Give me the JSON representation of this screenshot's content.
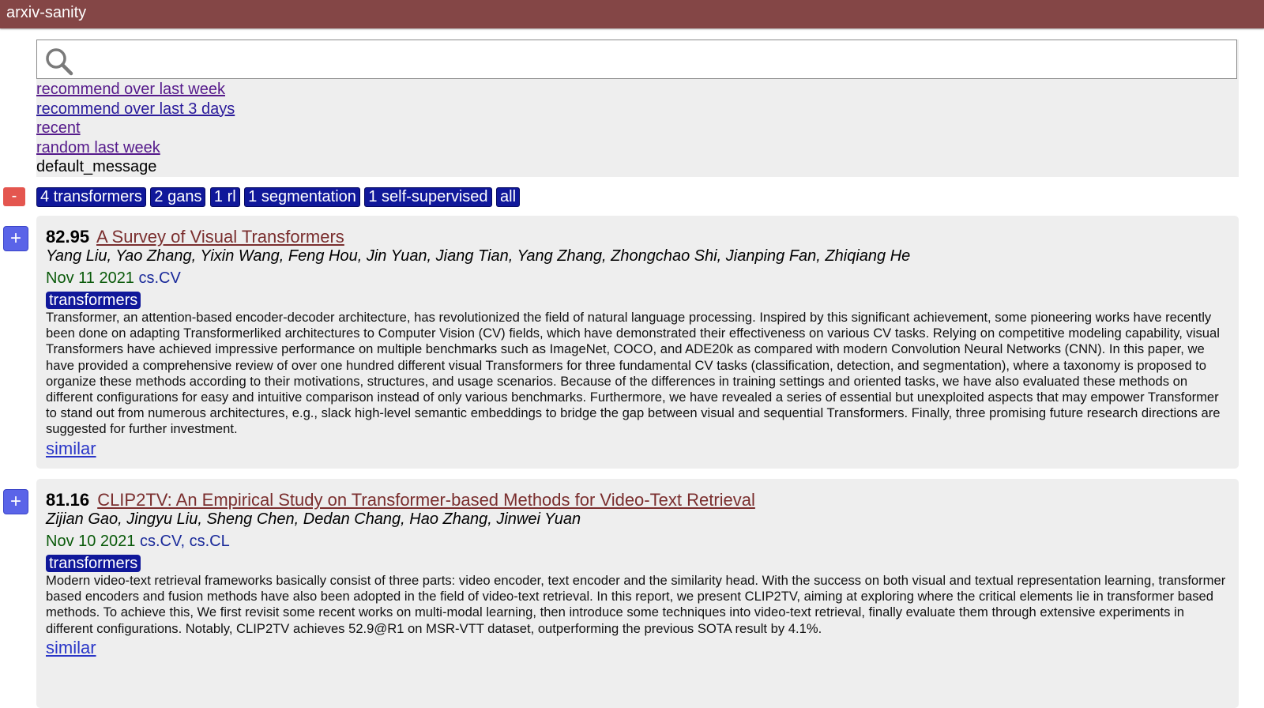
{
  "header": {
    "title": "arxiv-sanity"
  },
  "search": {
    "value": "",
    "placeholder": ""
  },
  "nav_links": [
    "recommend over last week",
    "recommend over last 3 days",
    "recent",
    "random last week"
  ],
  "message": "default_message",
  "tag_row": {
    "collapse_label": "-",
    "tags": [
      "4 transformers",
      "2 gans",
      "1 rl",
      "1 segmentation",
      "1 self-supervised",
      "all"
    ]
  },
  "papers": [
    {
      "add_label": "+",
      "score": "82.95",
      "title": "A Survey of Visual Transformers",
      "authors": "Yang Liu, Yao Zhang, Yixin Wang, Feng Hou, Jin Yuan, Jiang Tian, Yang Zhang, Zhongchao Shi, Jianping Fan, Zhiqiang He",
      "date": "Nov 11 2021",
      "categories": "cs.CV",
      "tag": "transformers",
      "abstract": "Transformer, an attention-based encoder-decoder architecture, has revolutionized the field of natural language processing. Inspired by this significant achievement, some pioneering works have recently been done on adapting Transformerliked architectures to Computer Vision (CV) fields, which have demonstrated their effectiveness on various CV tasks. Relying on competitive modeling capability, visual Transformers have achieved impressive performance on multiple benchmarks such as ImageNet, COCO, and ADE20k as compared with modern Convolution Neural Networks (CNN). In this paper, we have provided a comprehensive review of over one hundred different visual Transformers for three fundamental CV tasks (classification, detection, and segmentation), where a taxonomy is proposed to organize these methods according to their motivations, structures, and usage scenarios. Because of the differences in training settings and oriented tasks, we have also evaluated these methods on different configurations for easy and intuitive comparison instead of only various benchmarks. Furthermore, we have revealed a series of essential but unexploited aspects that may empower Transformer to stand out from numerous architectures, e.g., slack high-level semantic embeddings to bridge the gap between visual and sequential Transformers. Finally, three promising future research directions are suggested for further investment.",
      "similar_label": "similar"
    },
    {
      "add_label": "+",
      "score": "81.16",
      "title": "CLIP2TV: An Empirical Study on Transformer-based Methods for Video-Text Retrieval",
      "authors": "Zijian Gao, Jingyu Liu, Sheng Chen, Dedan Chang, Hao Zhang, Jinwei Yuan",
      "date": "Nov 10 2021",
      "categories": "cs.CV, cs.CL",
      "tag": "transformers",
      "abstract": "Modern video-text retrieval frameworks basically consist of three parts: video encoder, text encoder and the similarity head. With the success on both visual and textual representation learning, transformer based encoders and fusion methods have also been adopted in the field of video-text retrieval. In this report, we present CLIP2TV, aiming at exploring where the critical elements lie in transformer based methods. To achieve this, We first revisit some recent works on multi-modal learning, then introduce some techniques into video-text retrieval, finally evaluate them through extensive experiments in different configurations. Notably, CLIP2TV achieves 52.9@R1 on MSR-VTT dataset, outperforming the previous SOTA result by 4.1%.",
      "similar_label": "similar"
    }
  ]
}
